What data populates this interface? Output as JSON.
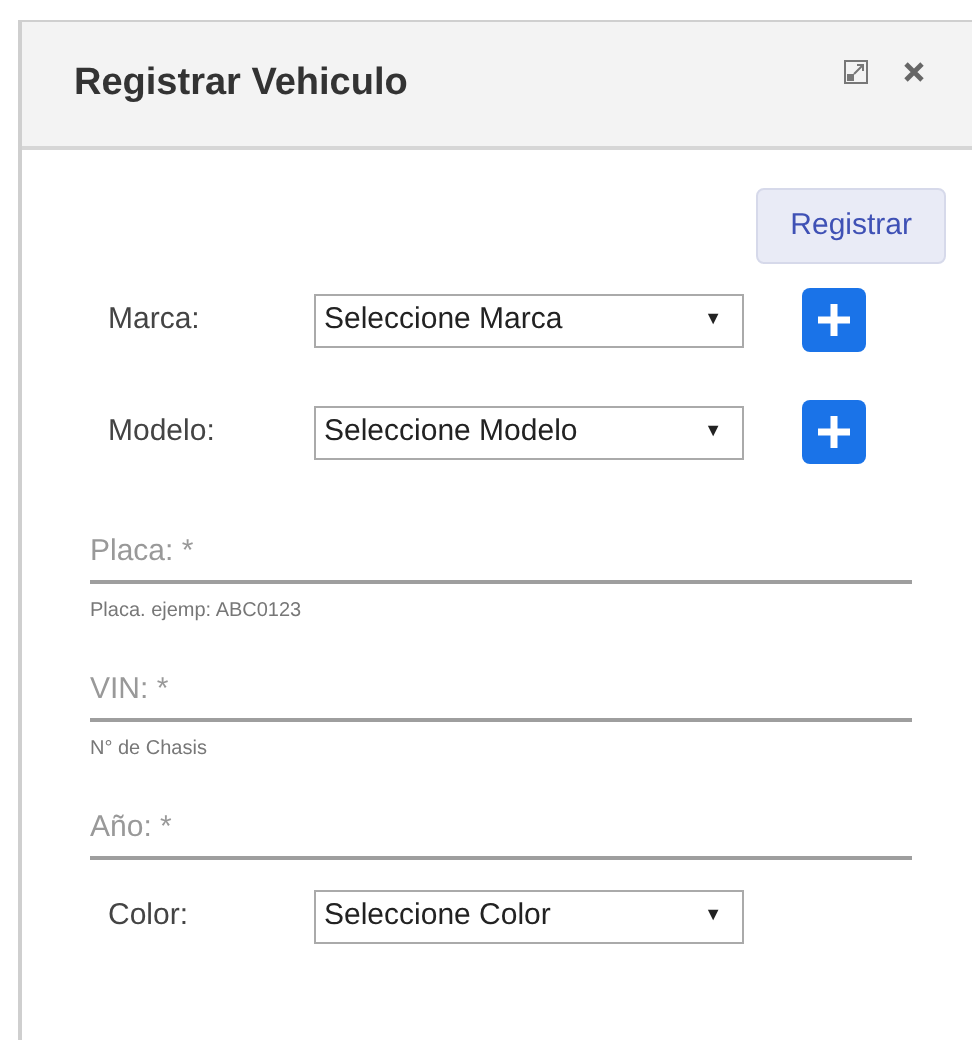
{
  "window": {
    "title": "Registrar Vehiculo"
  },
  "submit": {
    "label": "Registrar"
  },
  "fields": [
    {
      "kind": "select",
      "label": "Marca:",
      "value": "Seleccione Marca",
      "caret": "▼",
      "add_button": true
    },
    {
      "kind": "select",
      "label": "Modelo:",
      "value": "Seleccione Modelo",
      "caret": "▼",
      "add_button": true
    },
    {
      "kind": "text",
      "placeholder": "Placa: *",
      "hint": "Placa. ejemp: ABC0123"
    },
    {
      "kind": "text",
      "placeholder": "VIN: *",
      "hint": "N° de Chasis"
    },
    {
      "kind": "text",
      "placeholder": "Año: *"
    },
    {
      "kind": "select",
      "label": "Color:",
      "value": "Seleccione Color",
      "caret": "▼",
      "add_button": false
    }
  ]
}
